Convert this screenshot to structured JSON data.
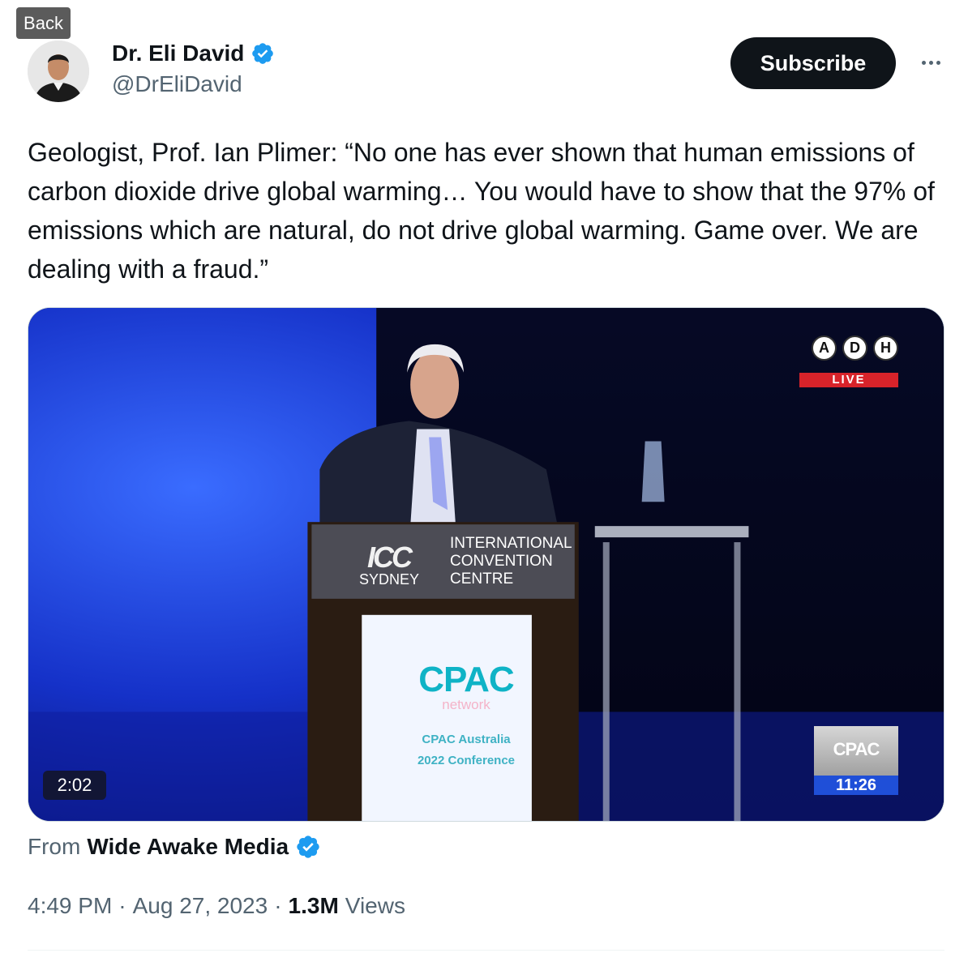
{
  "browser": {
    "back_tooltip": "Back"
  },
  "author": {
    "display_name": "Dr. Eli David",
    "handle": "@DrEliDavid",
    "verified": true,
    "verified_badge_color": "#1d9bf0"
  },
  "actions": {
    "subscribe_label": "Subscribe",
    "more_icon": "more-horizontal-icon"
  },
  "tweet": {
    "text": "Geologist, Prof. Ian Plimer: “No one has ever shown that human emissions of carbon dioxide drive global warming… You would have to show that the 97% of emissions which are natural, do not drive global warming. Game over. We are dealing with a fraud.”"
  },
  "video": {
    "duration": "2:02",
    "overlay": {
      "channel_letters": [
        "A",
        "D",
        "H"
      ],
      "live_label": "LIVE",
      "clock": "11:26",
      "corner_logo": "CPAC"
    },
    "podium_sign": {
      "mark": "ICC",
      "city": "SYDNEY",
      "lines": [
        "INTERNATIONAL",
        "CONVENTION",
        "CENTRE"
      ]
    },
    "podium_panel": {
      "title": "CPAC",
      "subtitle": "network",
      "line1": "CPAC Australia",
      "line2": "2022 Conference"
    }
  },
  "attribution": {
    "from_label": "From",
    "source_name": "Wide Awake Media",
    "verified": true
  },
  "meta": {
    "time": "4:49 PM",
    "separator": "·",
    "date": "Aug 27, 2023",
    "views_count": "1.3M",
    "views_label": "Views"
  }
}
